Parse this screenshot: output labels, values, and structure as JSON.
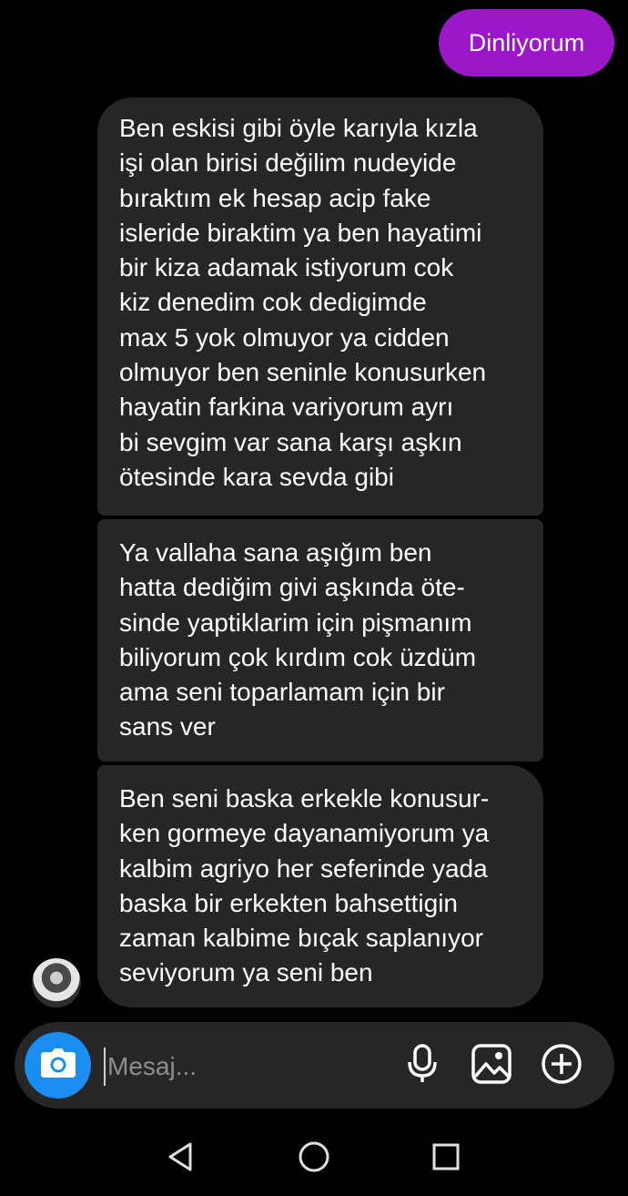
{
  "sent_message": {
    "text": "Dinliyorum"
  },
  "received_messages": [
    {
      "lines": [
        "Ben eskisi gibi öyle karıyla kızla",
        "işi olan birisi değilim nudeyide",
        "bıraktım ek hesap acip fake",
        "isleride biraktim ya ben hayatimi",
        "bir kiza adamak istiyorum cok",
        "kiz denedim cok dedigimde",
        "max 5 yok olmuyor ya cidden",
        "olmuyor ben seninle konusurken",
        "hayatin farkina variyorum ayrı",
        "bi sevgim var sana karşı aşkın",
        "ötesinde kara sevda gibi"
      ]
    },
    {
      "lines": [
        "Ya vallaha sana aşığım ben",
        "hatta dediğim givi aşkında öte-",
        "sinde yaptiklarim için pişmanım",
        "biliyorum çok kırdım cok üzdüm",
        "ama seni toparlamam için bir",
        "sans ver"
      ]
    },
    {
      "lines": [
        "Ben seni baska erkekle konusur-",
        "ken gormeye dayanamiyorum ya",
        "kalbim agriyo her seferinde yada",
        "baska bir erkekten bahsettigin",
        "zaman kalbime bıçak saplanıyor",
        "seviyorum ya seni ben"
      ]
    }
  ],
  "composer": {
    "placeholder": "Mesaj...",
    "icons": [
      "camera-icon",
      "microphone-icon",
      "gallery-icon",
      "plus-circle-icon"
    ]
  },
  "navigation": {
    "icons": [
      "back-triangle-icon",
      "home-circle-icon",
      "recents-square-icon"
    ]
  },
  "colors": {
    "background": "#000000",
    "sent_bubble": "#9b17c8",
    "received_bubble": "#262626",
    "camera_button": "#1a8df0"
  }
}
